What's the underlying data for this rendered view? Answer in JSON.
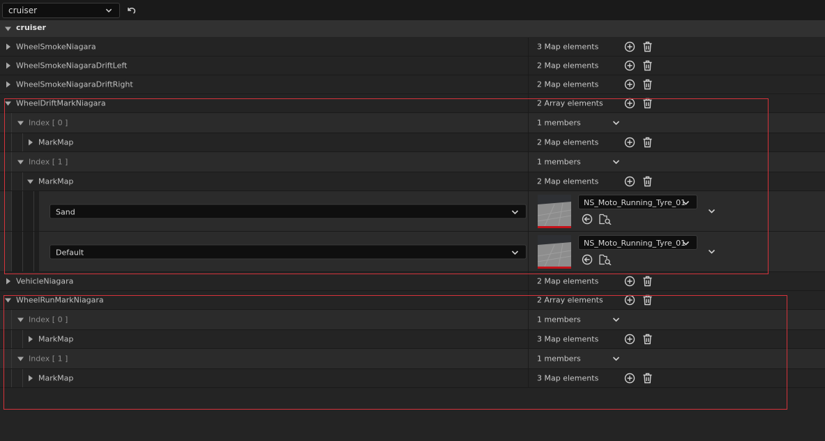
{
  "toolbar": {
    "combo_value": "cruiser"
  },
  "header": {
    "title": "cruiser"
  },
  "rows": {
    "wheel_smoke": {
      "label": "WheelSmokeNiagara",
      "value": "3 Map elements"
    },
    "wheel_smoke_left": {
      "label": "WheelSmokeNiagaraDriftLeft",
      "value": "2 Map elements"
    },
    "wheel_smoke_right": {
      "label": "WheelSmokeNiagaraDriftRight",
      "value": "2 Map elements"
    },
    "drift_mark": {
      "label": "WheelDriftMarkNiagara",
      "value": "2 Array elements"
    },
    "drift_idx0": {
      "label": "Index [ 0 ]",
      "value": "1 members"
    },
    "drift_idx0_map": {
      "label": "MarkMap",
      "value": "2 Map elements"
    },
    "drift_idx1": {
      "label": "Index [ 1 ]",
      "value": "1 members"
    },
    "drift_idx1_map": {
      "label": "MarkMap",
      "value": "2 Map elements"
    },
    "entry_sand": {
      "key": "Sand",
      "asset": "NS_Moto_Running_Tyre_01"
    },
    "entry_default": {
      "key": "Default",
      "asset": "NS_Moto_Running_Tyre_01"
    },
    "vehicle": {
      "label": "VehicleNiagara",
      "value": "2 Map elements"
    },
    "run_mark": {
      "label": "WheelRunMarkNiagara",
      "value": "2 Array elements"
    },
    "run_idx0": {
      "label": "Index [ 0 ]",
      "value": "1 members"
    },
    "run_idx0_map": {
      "label": "MarkMap",
      "value": "3 Map elements"
    },
    "run_idx1": {
      "label": "Index [ 1 ]",
      "value": "1 members"
    },
    "run_idx1_map": {
      "label": "MarkMap",
      "value": "3 Map elements"
    }
  },
  "colors": {
    "highlight": "#d6333b",
    "thumb_bar": "#c4121a",
    "background": "#242424"
  }
}
